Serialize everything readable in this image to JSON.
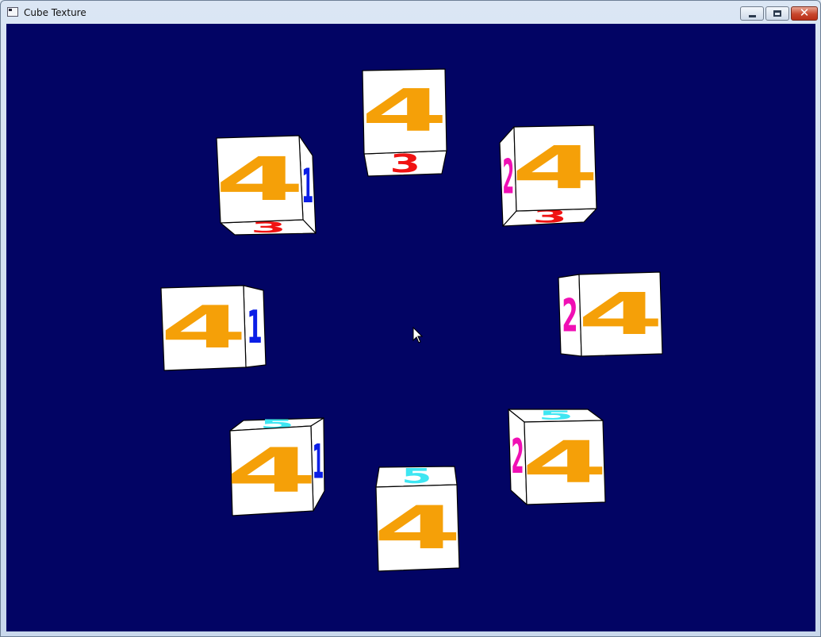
{
  "window": {
    "title": "Cube Texture"
  },
  "icons": {
    "app": "app-window-icon",
    "minimize": "minimize-icon",
    "maximize": "maximize-icon",
    "close": "close-icon",
    "cursor": "mouse-pointer-icon"
  },
  "colors": {
    "background": "#020464",
    "face_4": "#f5a008",
    "face_3": "#f01212",
    "face_2": "#f00fb4",
    "face_1": "#0a1ee6",
    "face_5": "#3ee6f2"
  },
  "cubes": [
    {
      "name": "cube-top",
      "front": "4",
      "bottom": "3"
    },
    {
      "name": "cube-top-left",
      "front": "4",
      "right": "1",
      "bottom": "3"
    },
    {
      "name": "cube-top-right",
      "front": "4",
      "left": "2",
      "bottom": "3"
    },
    {
      "name": "cube-left",
      "front": "4",
      "right": "1"
    },
    {
      "name": "cube-right",
      "front": "4",
      "left": "2"
    },
    {
      "name": "cube-bottom-left",
      "front": "4",
      "top": "5",
      "right": "1"
    },
    {
      "name": "cube-bottom-right",
      "front": "4",
      "top": "5",
      "left": "2"
    },
    {
      "name": "cube-bottom",
      "front": "4",
      "top": "5"
    }
  ]
}
